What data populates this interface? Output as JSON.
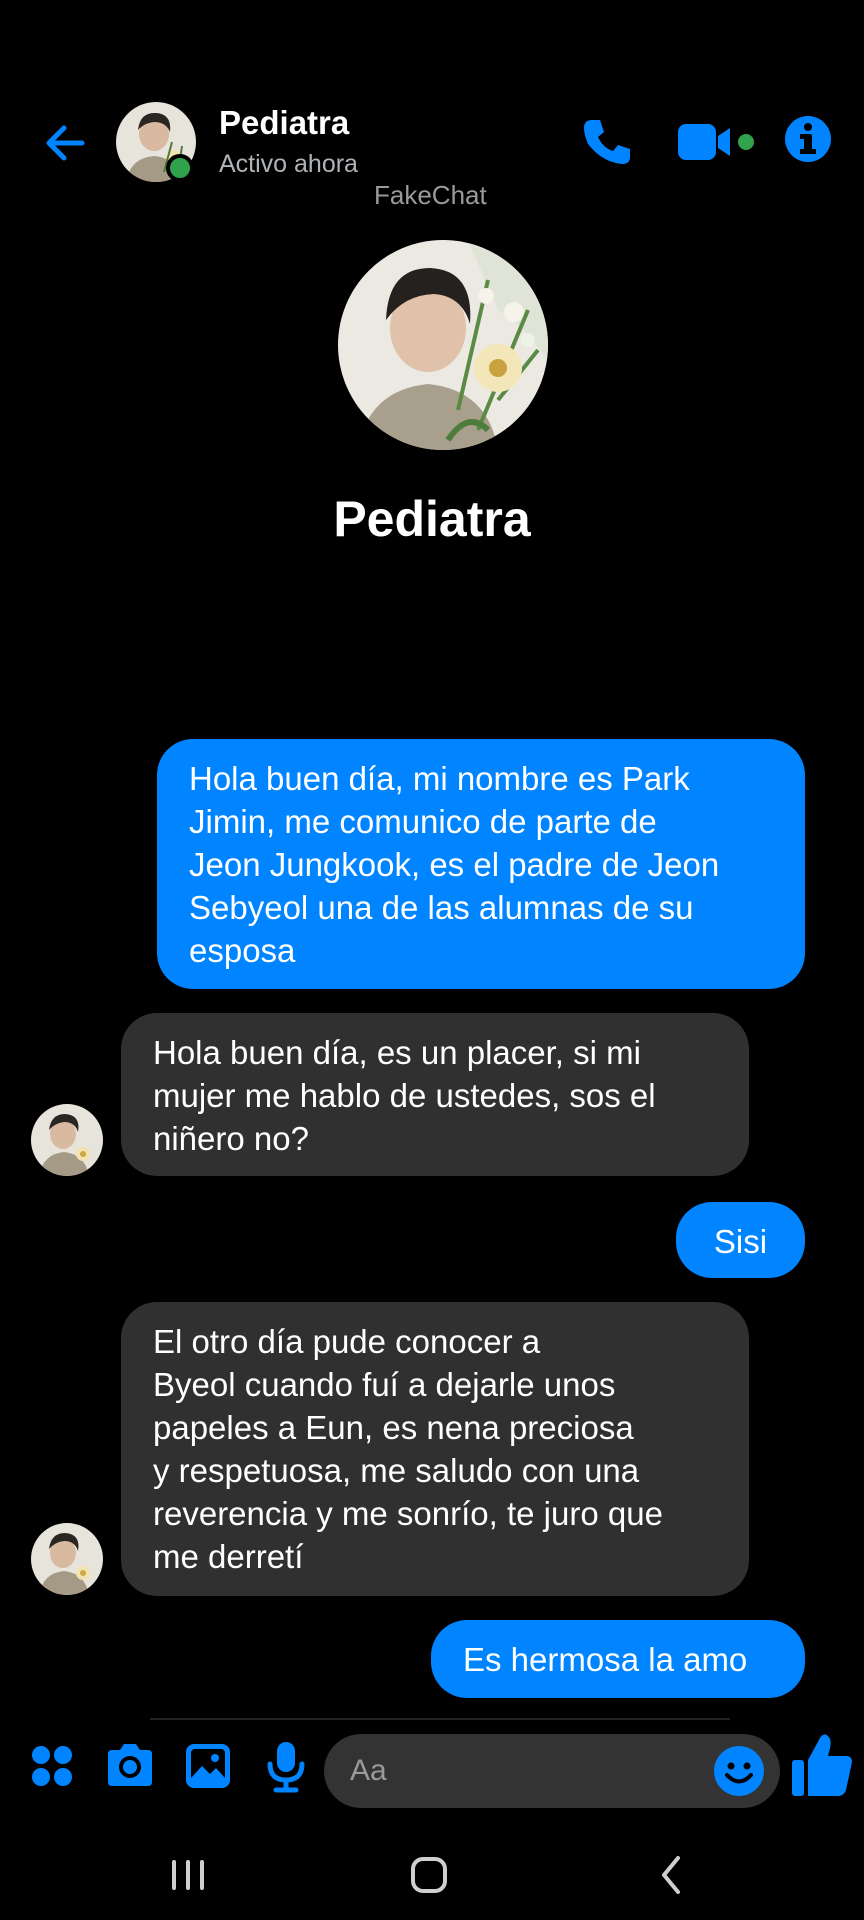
{
  "header": {
    "contact_name": "Pediatra",
    "status": "Activo ahora",
    "watermark": "FakeChat"
  },
  "profile": {
    "name": "Pediatra"
  },
  "messages": [
    {
      "direction": "sent",
      "text": "Hola buen día, mi nombre es Park\nJimin, me comunico de parte de\nJeon Jungkook, es el padre de Jeon\nSebyeol una de las alumnas de su\nesposa"
    },
    {
      "direction": "received",
      "text": "Hola buen día, es un placer, si mi\nmujer me hablo de ustedes, sos el\nniñero no?"
    },
    {
      "direction": "sent",
      "text": "Sisi"
    },
    {
      "direction": "received",
      "text": "El otro día pude conocer a\nByeol cuando fuí a dejarle unos\npapeles a Eun, es nena preciosa\ny respetuosa, me saludo con una\nreverencia y me sonrío, te juro que\nme derretí"
    },
    {
      "direction": "sent",
      "text": "Es hermosa la amo"
    }
  ],
  "composer": {
    "placeholder": "Aa"
  },
  "colors": {
    "accent": "#0084ff",
    "sent_bubble": "#0084ff",
    "received_bubble": "#303030",
    "online": "#31a24c",
    "background": "#000000"
  },
  "icons": [
    "back-arrow-icon",
    "phone-icon",
    "video-camera-icon",
    "info-icon",
    "apps-grid-icon",
    "camera-icon",
    "gallery-icon",
    "microphone-icon",
    "emoji-icon",
    "thumbs-up-icon",
    "recent-apps-icon",
    "home-icon",
    "nav-back-icon"
  ]
}
